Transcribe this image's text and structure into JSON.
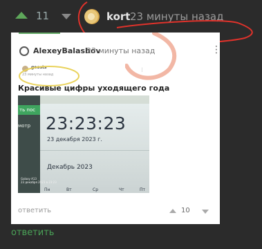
{
  "top": {
    "score": "11",
    "author": "kort",
    "time": "23 минуты назад"
  },
  "card": {
    "author": "AlexeyBalashov",
    "time": "23 минуты назад",
    "nested": {
      "author": "geosts",
      "time": "23 минуты назад"
    },
    "title": "Красивые цифры уходящего года",
    "photo": {
      "button_fragment": "ть пос",
      "left_text": "мотр",
      "clock": "23:23:23",
      "date": "23 декабря 2023 г.",
      "month": "Декабрь 2023",
      "watermark_line1": "Galaxy A13",
      "watermark_line2": "23 декабря 2023 в 23:23",
      "weekdays": [
        "Пн",
        "Вт",
        "Ср",
        "Чт",
        "Пт"
      ]
    },
    "footer": {
      "reply": "ответить",
      "score": "10"
    }
  },
  "bottom_reply": "ответить",
  "colors": {
    "background": "#2b2b2b",
    "accent_green": "#4aa257",
    "annotation_red": "#e0322b",
    "annotation_pink": "#f2b7a5",
    "annotation_yellow": "#e9d25a"
  },
  "icons": [
    "upvote-icon",
    "downvote-icon",
    "avatar",
    "more-options-icon"
  ]
}
